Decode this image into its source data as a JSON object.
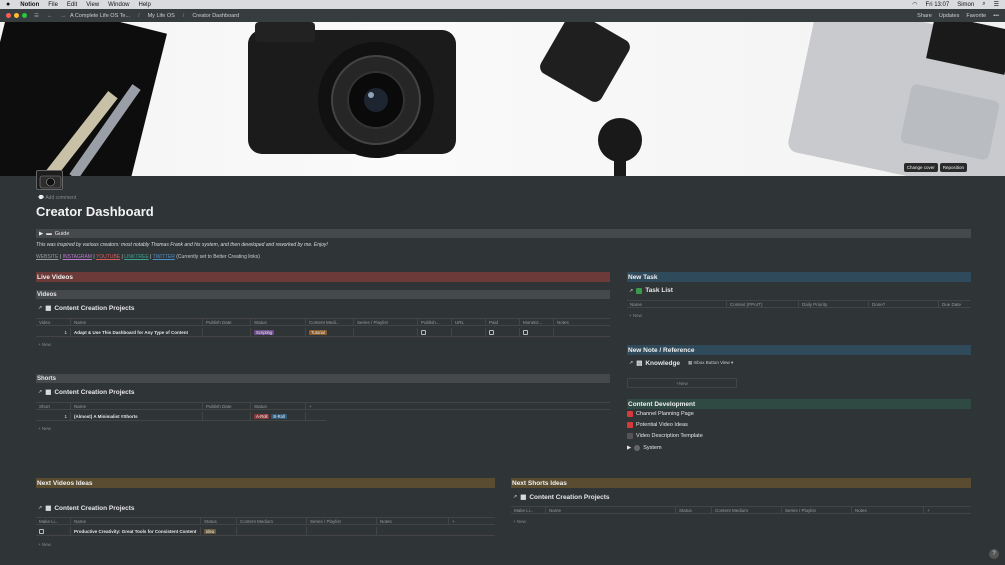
{
  "menubar": {
    "app": "Notion",
    "items": [
      "File",
      "Edit",
      "View",
      "Window",
      "Help"
    ],
    "clock": "Fri 13:07",
    "user": "Simon"
  },
  "titlebar": {
    "breadcrumbs": [
      "A Complete Life OS Te...",
      "My Life OS",
      "Creator Dashboard"
    ],
    "share": "Share",
    "updates": "Updates",
    "favorite": "Favorite"
  },
  "cover": {
    "change_cover": "Change cover",
    "reposition": "Reposition"
  },
  "page": {
    "add_comment": "Add comment",
    "title": "Creator Dashboard",
    "guide": "Guide",
    "intro": "This was inspired by various creators: most notably Thomas Frank and his system, and then developed and reworked by me. Enjoy!",
    "links": [
      "WEBSITE",
      "INSTAGRAM",
      "YOUTUBE",
      "LINKTREE",
      "TWITTER"
    ],
    "links_note": "(Currently set to Better Creating links)"
  },
  "sections": {
    "live_videos": "Live Videos",
    "videos": "Videos",
    "shorts": "Shorts",
    "next_videos": "Next Videos Ideas",
    "next_shorts": "Next Shorts Ideas",
    "new_task": "New Task",
    "new_note": "New Note / Reference",
    "content_dev": "Content Development"
  },
  "db_titles": {
    "content_projects": "Content Creation Projects",
    "task_list": "Task List",
    "knowledge": "Knowledge",
    "inbox_view": "Inbox Button View"
  },
  "videos_table": {
    "columns": [
      "Video",
      "Name",
      "Publish Date",
      "Status",
      "Content Medi...",
      "Series / Playlist",
      "Publish...",
      "URL",
      "Paid",
      "Monetiz...",
      "Notes"
    ],
    "rows": [
      {
        "num": "1",
        "name": "Adapt & Use This Dashboard for Any Type of Content",
        "status": "Scripting",
        "medium": "Tutorial"
      }
    ]
  },
  "shorts_table": {
    "columns": [
      "Short",
      "Name",
      "Publish Date",
      "Status"
    ],
    "rows": [
      {
        "num": "1",
        "name": "(Almost) A Minimalist #Shorts",
        "tag1": "A-Roll",
        "tag2": "B-Roll"
      }
    ]
  },
  "next_videos_table": {
    "columns": [
      "Make Li...",
      "Name",
      "Status",
      "Content Medium",
      "Series / Playlist",
      "Notes"
    ],
    "rows": [
      {
        "name": "Productive Creativity: Great Tools for Consistent Content",
        "status": "Idea"
      }
    ]
  },
  "next_shorts_table": {
    "columns": [
      "Make Li...",
      "Name",
      "Status",
      "Content Medium",
      "Series / Playlist",
      "Notes"
    ]
  },
  "task_table": {
    "columns": [
      "Name",
      "Context (PPorT)",
      "Daily Priority",
      "Done?",
      "Due Date"
    ]
  },
  "new_label": "New",
  "content_dev_items": [
    "Channel Planning Page",
    "Potential Video Ideas",
    "Video Description Template",
    "System"
  ],
  "help": "?"
}
